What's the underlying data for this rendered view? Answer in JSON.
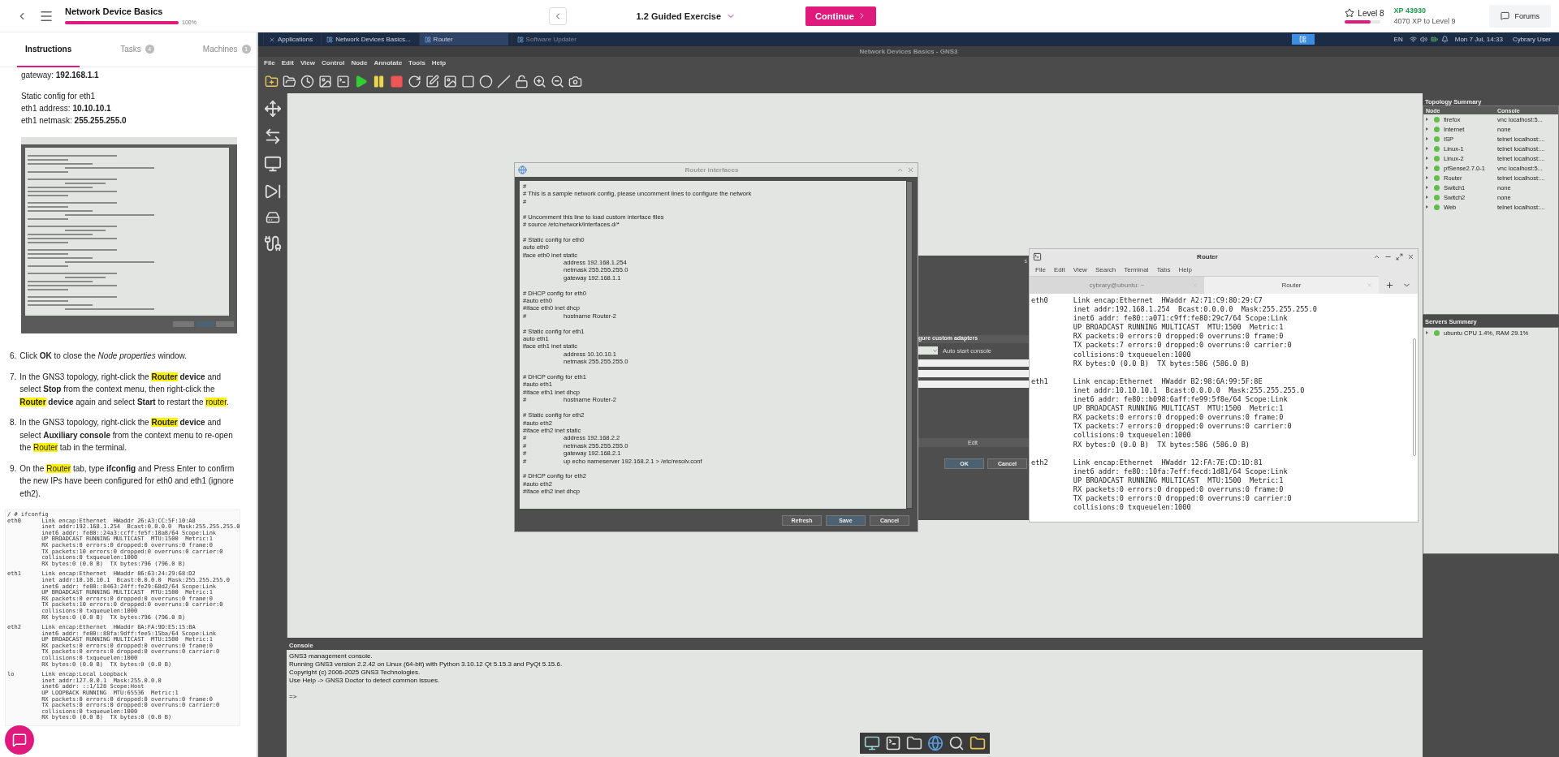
{
  "topbar": {
    "course_title": "Network Device Basics",
    "course_progress": {
      "level": 1,
      "reading": "100%"
    },
    "exercise": "1.2 Guided Exercise",
    "continue_label": "Continue",
    "level_label": "Level 8",
    "level_progress": {
      "level": 0.72
    },
    "xp": "XP 43930",
    "xp_to_next": "4070 XP to Level 9",
    "forums_label": "Forums"
  },
  "instruction_tabs": [
    {
      "label": "Instructions",
      "selected": true
    },
    {
      "label": "Tasks",
      "count": "4",
      "selected": false
    },
    {
      "label": "Machines",
      "count": "1",
      "selected": false
    }
  ],
  "instructions": {
    "intro_groups": [
      [
        [
          {
            "text": "gateway: "
          },
          {
            "text": "192.168.1.1",
            "bold": true
          }
        ]
      ],
      [
        [
          {
            "text": "Static config for eth1"
          }
        ],
        [
          {
            "text": "eth1 address: "
          },
          {
            "text": "10.10.10.1",
            "bold": true
          }
        ],
        [
          {
            "text": "eth1 netmask: "
          },
          {
            "text": "255.255.255.0",
            "bold": true
          }
        ]
      ]
    ],
    "steps": [
      {
        "number": "6.",
        "segments": [
          {
            "text": "Click "
          },
          {
            "text": "OK",
            "bold": true
          },
          {
            "text": " to close the "
          },
          {
            "text": "Node properties",
            "italic": true
          },
          {
            "text": " window."
          }
        ]
      },
      {
        "number": "7.",
        "segments": [
          {
            "text": "In the GNS3 topology, right-click the "
          },
          {
            "text": "Router",
            "bold": true,
            "highlight": true
          },
          {
            "text": " device",
            "bold": true
          },
          {
            "text": " and select "
          },
          {
            "text": "Stop",
            "bold": true
          },
          {
            "text": " from the context menu, then right-click the "
          },
          {
            "text": "Router",
            "bold": true,
            "highlight": true
          },
          {
            "text": " device",
            "bold": true
          },
          {
            "text": " again and select "
          },
          {
            "text": "Start",
            "bold": true
          },
          {
            "text": " to restart the "
          },
          {
            "text": "router",
            "highlight": true
          },
          {
            "text": "."
          }
        ]
      },
      {
        "number": "8.",
        "segments": [
          {
            "text": "In the GNS3 topology, right-click the "
          },
          {
            "text": "Router",
            "bold": true,
            "highlight": true
          },
          {
            "text": " device",
            "bold": true
          },
          {
            "text": " and select "
          },
          {
            "text": "Auxiliary console",
            "bold": true
          },
          {
            "text": " from the context menu to re-open the "
          },
          {
            "text": "Router",
            "highlight": true
          },
          {
            "text": " tab in the terminal."
          }
        ]
      },
      {
        "number": "9.",
        "segments": [
          {
            "text": "On the "
          },
          {
            "text": "Router",
            "highlight": true
          },
          {
            "text": " tab, type "
          },
          {
            "text": "ifconfig",
            "bold": true
          },
          {
            "text": " and Press Enter to confirm the new IPs have been configured for eth0 and eth1 (ignore eth2)."
          }
        ]
      }
    ],
    "code_blocks": [
      [
        "/ # ifconfig",
        "eth0      Link encap:Ethernet  HWaddr 26:A3:CC:5F:10:A8",
        "          inet addr:192.168.1.254  Bcast:0.0.0.0  Mask:255.255.255.0",
        "          inet6 addr: fe80::24a3:ccff:fe5f:10a8/64 Scope:Link",
        "          UP BROADCAST RUNNING MULTICAST  MTU:1500  Metric:1",
        "          RX packets:0 errors:0 dropped:0 overruns:0 frame:0",
        "          TX packets:10 errors:0 dropped:0 overruns:0 carrier:0",
        "          collisions:0 txqueuelen:1000",
        "          RX bytes:0 (0.0 B)  TX bytes:796 (796.0 B)"
      ],
      [
        "eth1      Link encap:Ethernet  HWaddr 86:63:24:29:68:D2",
        "          inet addr:10.10.10.1  Bcast:0.0.0.0  Mask:255.255.255.0",
        "          inet6 addr: fe80::8463:24ff:fe29:68d2/64 Scope:Link",
        "          UP BROADCAST RUNNING MULTICAST  MTU:1500  Metric:1",
        "          RX packets:0 errors:0 dropped:0 overruns:0 frame:0",
        "          TX packets:10 errors:0 dropped:0 overruns:0 carrier:0",
        "          collisions:0 txqueuelen:1000",
        "          RX bytes:0 (0.0 B)  TX bytes:796 (796.0 B)"
      ],
      [
        "eth2      Link encap:Ethernet  HWaddr 8A:FA:9D:E5:15:BA",
        "          inet6 addr: fe80::88fa:9dff:fee5:15ba/64 Scope:Link",
        "          UP BROADCAST RUNNING MULTICAST  MTU:1500  Metric:1",
        "          RX packets:0 errors:0 dropped:0 overruns:0 frame:0",
        "          TX packets:0 errors:0 dropped:0 overruns:0 carrier:0",
        "          collisions:0 txqueuelen:1000",
        "          RX bytes:0 (0.0 B)  TX bytes:0 (0.0 B)"
      ],
      [
        "lo        Link encap:Local Loopback",
        "          inet addr:127.0.0.1  Mask:255.0.0.0",
        "          inet6 addr: ::1/128 Scope:Host",
        "          UP LOOPBACK RUNNING  MTU:65536  Metric:1",
        "          RX packets:0 errors:0 dropped:0 overruns:0 frame:0",
        "          TX packets:0 errors:0 dropped:0 overruns:0 carrier:0",
        "          collisions:0 txqueuelen:1000",
        "          RX bytes:0 (0.0 B)  TX bytes:0 (0.0 B)"
      ]
    ]
  },
  "taskbar": {
    "items": [
      {
        "label": "Applications",
        "kind": "menu",
        "selected": false
      },
      {
        "label": "Network Devices Basics...",
        "kind": "window",
        "selected": false
      },
      {
        "label": "Router",
        "kind": "window",
        "selected": true
      },
      {
        "label": "Software Updater",
        "kind": "window",
        "selected": false
      }
    ],
    "language": "EN",
    "clock": "Mon 7 Jul, 14:33",
    "user": "Cybrary User"
  },
  "gns3": {
    "title": "Network Devices Basics - GNS3",
    "menu": [
      "File",
      "Edit",
      "View",
      "Control",
      "Node",
      "Annotate",
      "Tools",
      "Help"
    ],
    "interfaces_dialog": {
      "title": "Router interfaces",
      "blocks": [
        [
          "#",
          "# This is a sample network config, please uncomment lines to configure the network",
          "#"
        ],
        [
          "# Uncomment this line to load custom interface files",
          "# source /etc/network/interfaces.d/*"
        ],
        [
          "# Static config for eth0",
          "auto eth0",
          "iface eth0 inet static",
          "\taddress 192.168.1.254",
          "\tnetmask 255.255.255.0",
          "\tgateway 192.168.1.1"
        ],
        [
          "# DHCP config for eth0",
          "#auto eth0",
          "#iface eth0 inet dhcp",
          "#\thostname Router-2"
        ],
        [
          "# Static config for eth1",
          "auto eth1",
          "iface eth1 inet static",
          "\taddress 10.10.10.1",
          "\tnetmask 255.255.255.0"
        ],
        [
          "# DHCP config for eth1",
          "#auto eth1",
          "#iface eth1 inet dhcp",
          "#\thostname Router-2"
        ],
        [
          "# Static config for eth2",
          "#auto eth2",
          "#iface eth2 inet static",
          "#\taddress 192.168.2.2",
          "#\tnetmask 255.255.255.0",
          "#\tgateway 192.168.2.1",
          "#\tup echo nameserver 192.168.2.1 > /etc/resolv.conf"
        ],
        [
          "# DHCP config for eth2",
          "#auto eth2",
          "#iface eth2 inet dhcp"
        ]
      ],
      "buttons": [
        "Refresh",
        "Save",
        "Cancel"
      ]
    },
    "properties_dialog": {
      "title_fragment": "s",
      "section": "gure custom adapters",
      "option": "Auto start console",
      "edit_label": "Edit",
      "ok_label": "OK",
      "cancel_label": "Cancel"
    },
    "topology": {
      "title": "Topology Summary",
      "columns": [
        "Node",
        "Console"
      ],
      "nodes": [
        {
          "name": "firefox",
          "console": "vnc localhost:5..."
        },
        {
          "name": "Internet",
          "console": "none"
        },
        {
          "name": "ISP",
          "console": "telnet localhost:..."
        },
        {
          "name": "Linux-1",
          "console": "telnet localhost:..."
        },
        {
          "name": "Linux-2",
          "console": "telnet localhost:..."
        },
        {
          "name": "pfSense2.7.0-1",
          "console": "vnc localhost:5..."
        },
        {
          "name": "Router",
          "console": "telnet localhost:..."
        },
        {
          "name": "Switch1",
          "console": "none"
        },
        {
          "name": "Switch2",
          "console": "none"
        },
        {
          "name": "Web",
          "console": "telnet localhost:..."
        }
      ]
    },
    "servers": {
      "title": "Servers Summary",
      "items": [
        {
          "label": "ubuntu CPU 1.4%, RAM 29.1%"
        }
      ]
    },
    "console": {
      "title": "Console",
      "lines": [
        "GNS3 management console.",
        "Running GNS3 version 2.2.42 on Linux (64-bit) with Python 3.10.12 Qt 5.15.3 and PyQt 5.15.6.",
        "Copyright (c) 2006-2025 GNS3 Technologies.",
        "Use Help -> GNS3 Doctor to detect common issues."
      ],
      "prompt": "=>"
    }
  },
  "terminal": {
    "title": "Router",
    "menu": [
      "File",
      "Edit",
      "View",
      "Search",
      "Terminal",
      "Tabs",
      "Help"
    ],
    "tabs": [
      {
        "label": "cybrary@ubuntu: ~",
        "selected": false
      },
      {
        "label": "Router",
        "selected": true
      }
    ],
    "blocks": [
      [
        "eth0      Link encap:Ethernet  HWaddr A2:71:C9:80:29:C7",
        "          inet addr:192.168.1.254  Bcast:0.0.0.0  Mask:255.255.255.0",
        "          inet6 addr: fe80::a071:c9ff:fe80:29c7/64 Scope:Link",
        "          UP BROADCAST RUNNING MULTICAST  MTU:1500  Metric:1",
        "          RX packets:0 errors:0 dropped:0 overruns:0 frame:0",
        "          TX packets:7 errors:0 dropped:0 overruns:0 carrier:0",
        "          collisions:0 txqueuelen:1000",
        "          RX bytes:0 (0.0 B)  TX bytes:586 (586.0 B)"
      ],
      [
        "eth1      Link encap:Ethernet  HWaddr B2:98:6A:99:5F:8E",
        "          inet addr:10.10.10.1  Bcast:0.0.0.0  Mask:255.255.255.0",
        "          inet6 addr: fe80::b098:6aff:fe99:5f8e/64 Scope:Link",
        "          UP BROADCAST RUNNING MULTICAST  MTU:1500  Metric:1",
        "          RX packets:0 errors:0 dropped:0 overruns:0 frame:0",
        "          TX packets:7 errors:0 dropped:0 overruns:0 carrier:0",
        "          collisions:0 txqueuelen:1000",
        "          RX bytes:0 (0.0 B)  TX bytes:586 (586.0 B)"
      ],
      [
        "eth2      Link encap:Ethernet  HWaddr 12:FA:7E:CD:1D:81",
        "          inet6 addr: fe80::10fa:7eff:fecd:1d81/64 Scope:Link",
        "          UP BROADCAST RUNNING MULTICAST  MTU:1500  Metric:1",
        "          RX packets:0 errors:0 dropped:0 overruns:0 frame:0",
        "          TX packets:0 errors:0 dropped:0 overruns:0 carrier:0",
        "          collisions:0 txqueuelen:1000"
      ]
    ]
  }
}
